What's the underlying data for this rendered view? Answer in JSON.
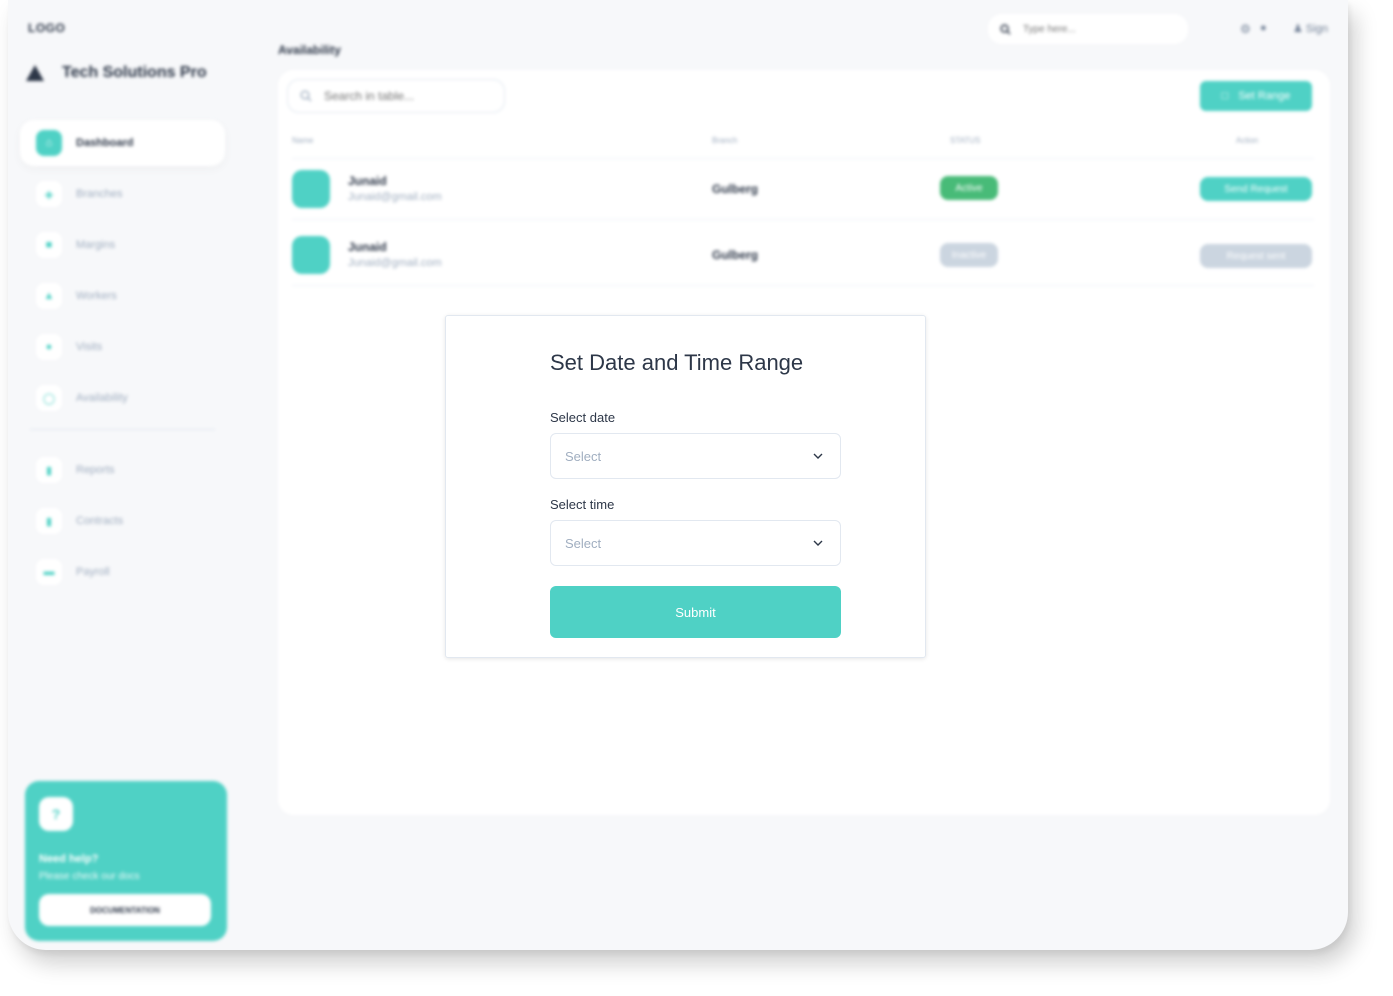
{
  "topbar": {
    "logo": "LOGO",
    "page_title": "Availability",
    "search_placeholder": "Type here...",
    "signin": "Sign"
  },
  "sidebar": {
    "brand": "Tech Solutions Pro",
    "items": [
      {
        "label": "Dashboard",
        "icon": "home-icon",
        "active": true
      },
      {
        "label": "Branches",
        "icon": "branch-icon"
      },
      {
        "label": "Margins",
        "icon": "margin-icon"
      },
      {
        "label": "Workers",
        "icon": "workers-icon"
      },
      {
        "label": "Visits",
        "icon": "visits-icon"
      },
      {
        "label": "Availability",
        "icon": "clock-icon"
      }
    ],
    "items2": [
      {
        "label": "Reports",
        "icon": "reports-icon"
      },
      {
        "label": "Contracts",
        "icon": "contracts-icon"
      },
      {
        "label": "Payroll",
        "icon": "payroll-icon"
      }
    ],
    "help": {
      "title": "Need help?",
      "subtitle": "Please check our docs",
      "button": "DOCUMENTATION"
    }
  },
  "table": {
    "search_placeholder": "Search in table...",
    "set_range_label": "Set Range",
    "headers": {
      "name": "Name",
      "branch": "Branch",
      "status": "STATUS",
      "action": "Action"
    },
    "rows": [
      {
        "name": "Junaid",
        "email": "Junaid@gmail.com",
        "branch": "Gulberg",
        "status": "Active",
        "status_color": "#48bb78",
        "action": "Send Request",
        "action_color": "#4fd1c5"
      },
      {
        "name": "Junaid",
        "email": "Junaid@gmail.com",
        "branch": "Gulberg",
        "status": "Inactive",
        "status_color": "#cbd5e0",
        "action": "Request sent",
        "action_color": "#cbd5e0"
      }
    ]
  },
  "modal": {
    "title": "Set Date and Time Range",
    "date_label": "Select date",
    "date_value": "Select",
    "time_label": "Select time",
    "time_value": "Select",
    "submit": "Submit"
  },
  "colors": {
    "accent": "#4fd1c5",
    "active_green": "#48bb78",
    "inactive_gray": "#cbd5e0"
  }
}
